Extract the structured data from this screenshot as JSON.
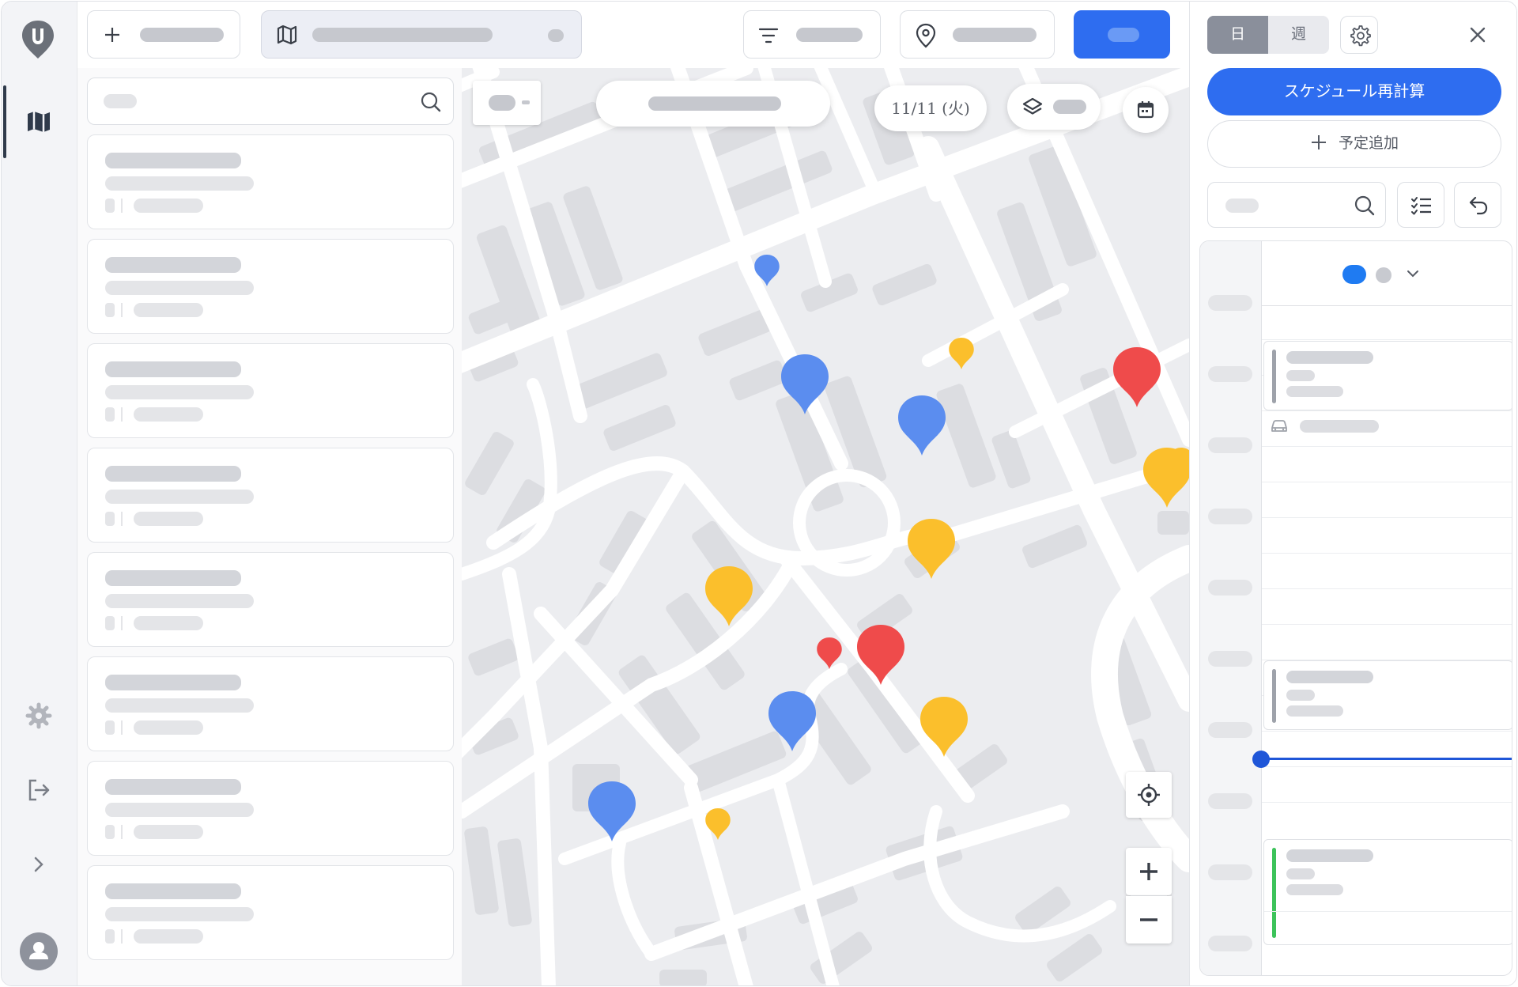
{
  "map_header": {
    "date_label": "11/11 (火)"
  },
  "right_panel": {
    "view_day": "日",
    "view_week": "週",
    "recalc_label": "スケジュール再計算",
    "add_plan_label": "予定追加",
    "add_plan_icon": "plus-icon"
  },
  "colors": {
    "primary": "#2e6df0",
    "marker_blue": "#5b8def",
    "marker_yellow": "#fbbf2c",
    "marker_red": "#ef4b4b",
    "current_time": "#1f56d8",
    "event_green": "#3cc35a",
    "event_gray": "#9ea2aa"
  }
}
